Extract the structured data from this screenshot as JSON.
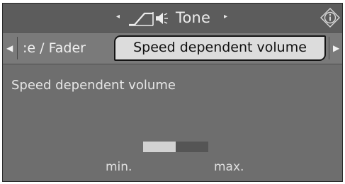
{
  "header": {
    "title": "Tone",
    "left_arrow": "◂",
    "right_arrow": "▸",
    "tone_icon": "tone-curve-speaker-icon",
    "info_icon": "info-icon"
  },
  "tabs": {
    "left_arrow": "◀",
    "right_arrow": "▶",
    "items": [
      {
        "label": ":e / Fader",
        "active": false
      },
      {
        "label": "Speed dependent volume",
        "active": true
      }
    ]
  },
  "content": {
    "heading": "Speed dependent volume",
    "level": {
      "value_fraction": 0.5,
      "min_label": "min.",
      "max_label": "max."
    }
  },
  "colors": {
    "background": "#6e6e6e",
    "active_tab": "#dcdcdc",
    "level_fill": "#d2d2d2",
    "level_track": "#555555"
  }
}
